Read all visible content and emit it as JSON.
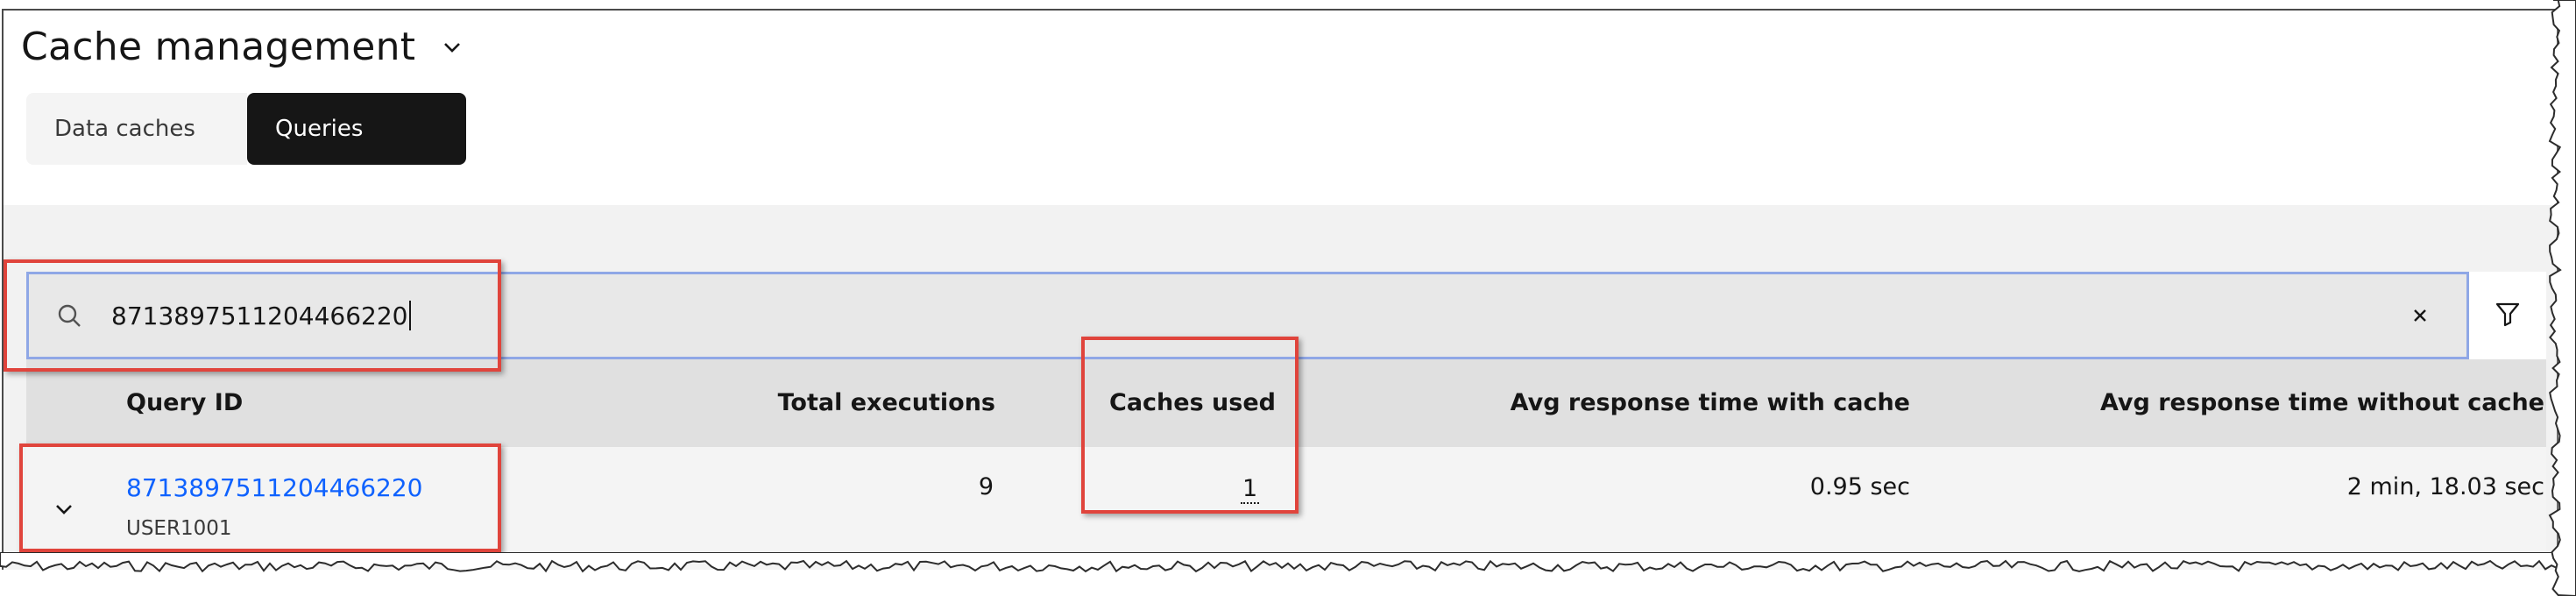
{
  "header": {
    "title": "Cache management"
  },
  "switcher": {
    "tabs": [
      {
        "label": "Data caches"
      },
      {
        "label": "Queries"
      }
    ]
  },
  "search": {
    "value": "8713897511204466220"
  },
  "table": {
    "columns": {
      "query_id": "Query ID",
      "total_executions": "Total executions",
      "caches_used": "Caches used",
      "avg_with_cache": "Avg response time with cache",
      "avg_without_cache": "Avg response time without cache"
    },
    "rows": [
      {
        "query_id": "8713897511204466220",
        "user": "USER1001",
        "total_executions": "9",
        "caches_used": "1",
        "avg_with_cache": "0.95 sec",
        "avg_without_cache": "2 min, 18.03 sec"
      }
    ]
  },
  "colors": {
    "link": "#0f62fe",
    "highlight": "#e0443c",
    "active_tab": "#161616",
    "search_focus": "#8fa7e6"
  },
  "icons": [
    "chevron-down-icon",
    "search-icon",
    "close-icon",
    "filter-icon",
    "expand-chevron-icon"
  ]
}
